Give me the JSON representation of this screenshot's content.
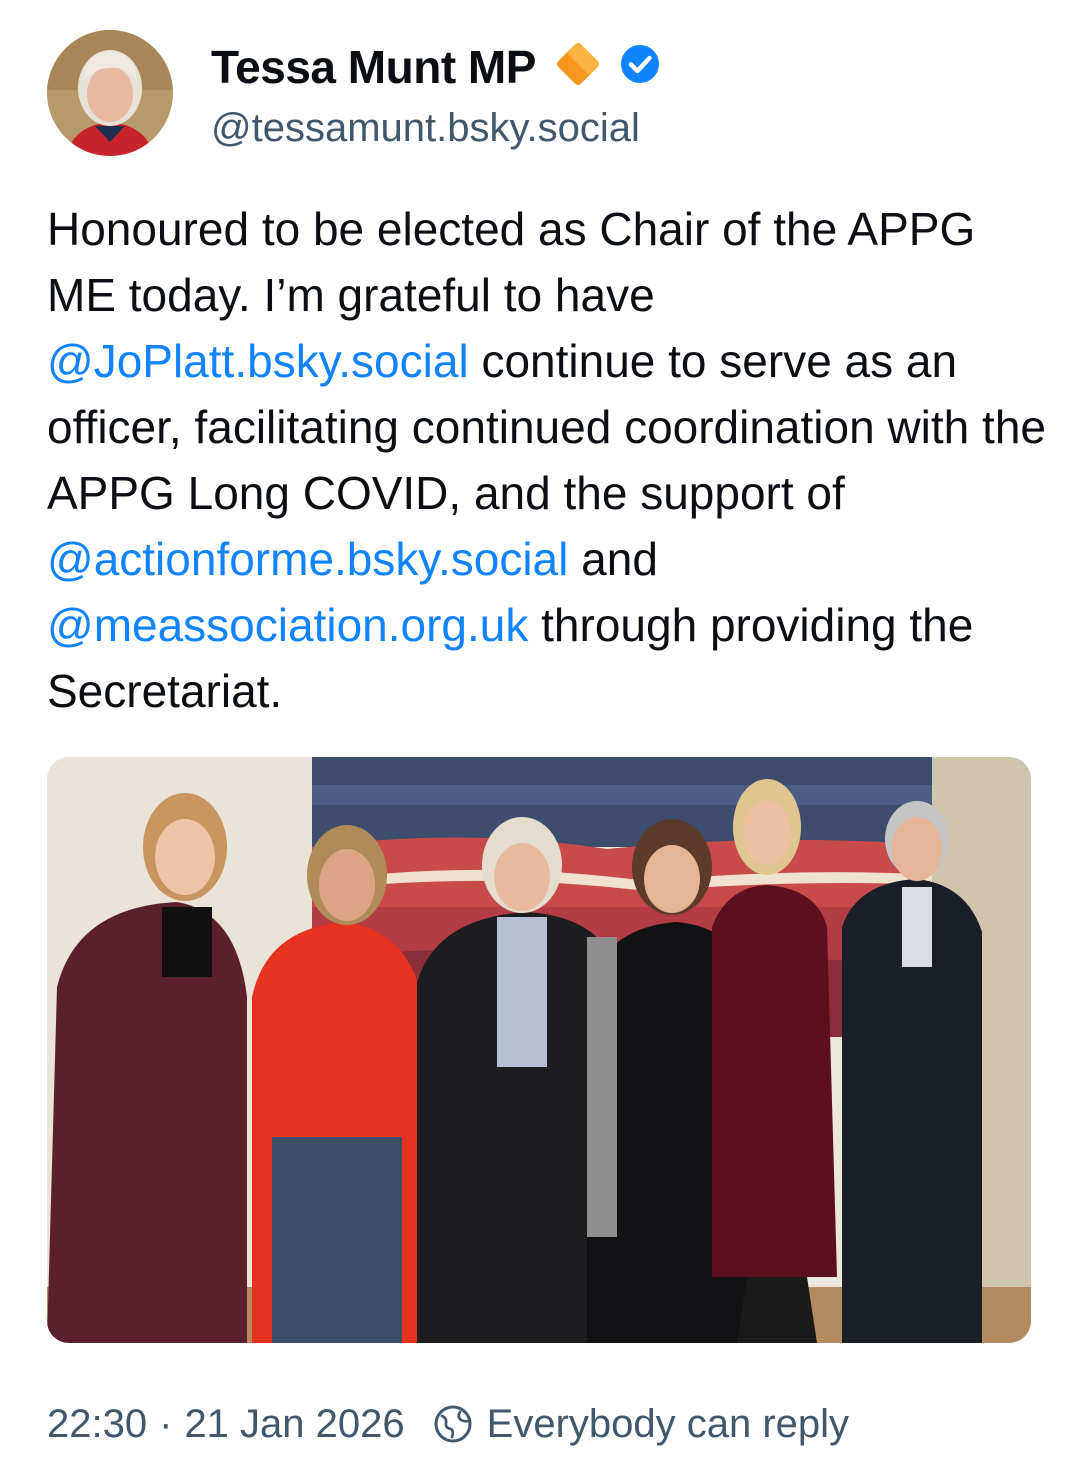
{
  "author": {
    "display_name": "Tessa Munt MP",
    "handle": "@tessamunt.bsky.social",
    "badges": [
      "orange-diamond-icon",
      "verified-check-icon"
    ]
  },
  "post": {
    "segments": [
      {
        "type": "text",
        "value": "Honoured to be elected as Chair of the APPG ME today. I’m grateful to have "
      },
      {
        "type": "mention",
        "value": "@JoPlatt.bsky.social"
      },
      {
        "type": "text",
        "value": " continue to serve as an officer, facilitating continued coordination with the APPG Long COVID, and the support of "
      },
      {
        "type": "mention",
        "value": "@actionforme.bsky.social"
      },
      {
        "type": "text",
        "value": " and "
      },
      {
        "type": "mention",
        "value": "@meassociation.org.uk"
      },
      {
        "type": "text",
        "value": " through providing the Secretariat."
      }
    ]
  },
  "meta": {
    "time": "22:30",
    "separator": "·",
    "date": "21 Jan 2026",
    "reply_setting": "Everybody can reply"
  },
  "colors": {
    "link": "#1083fe",
    "muted": "#42576c",
    "verified": "#1083fe",
    "badge_orange": "#f8961d"
  }
}
